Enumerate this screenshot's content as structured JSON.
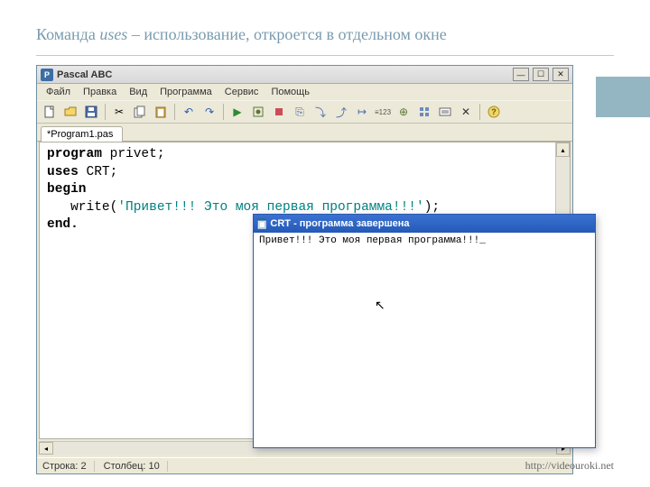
{
  "slide": {
    "title_pre": "Команда ",
    "title_uses": "uses",
    "title_post": " – использование, откроется в отдельном окне"
  },
  "ide": {
    "title": "Pascal ABC",
    "menu": [
      "Файл",
      "Правка",
      "Вид",
      "Программа",
      "Сервис",
      "Помощь"
    ],
    "tab": "*Program1.pas",
    "code": {
      "l1_kw": "program",
      "l1_rest": " privet;",
      "l2_kw": "uses",
      "l2_rest": " CRT;",
      "l3_kw": "begin",
      "l4_ind": "   write(",
      "l4_str": "'Привет!!! Это моя первая программа!!!'",
      "l4_end": ");",
      "l5_kw": "end."
    },
    "status": {
      "row": "Строка: 2",
      "col": "Столбец: 10"
    }
  },
  "crt": {
    "title": "CRT - программа завершена",
    "output": "Привет!!! Это моя первая программа!!!_"
  },
  "watermark": "http://videouroki.net"
}
